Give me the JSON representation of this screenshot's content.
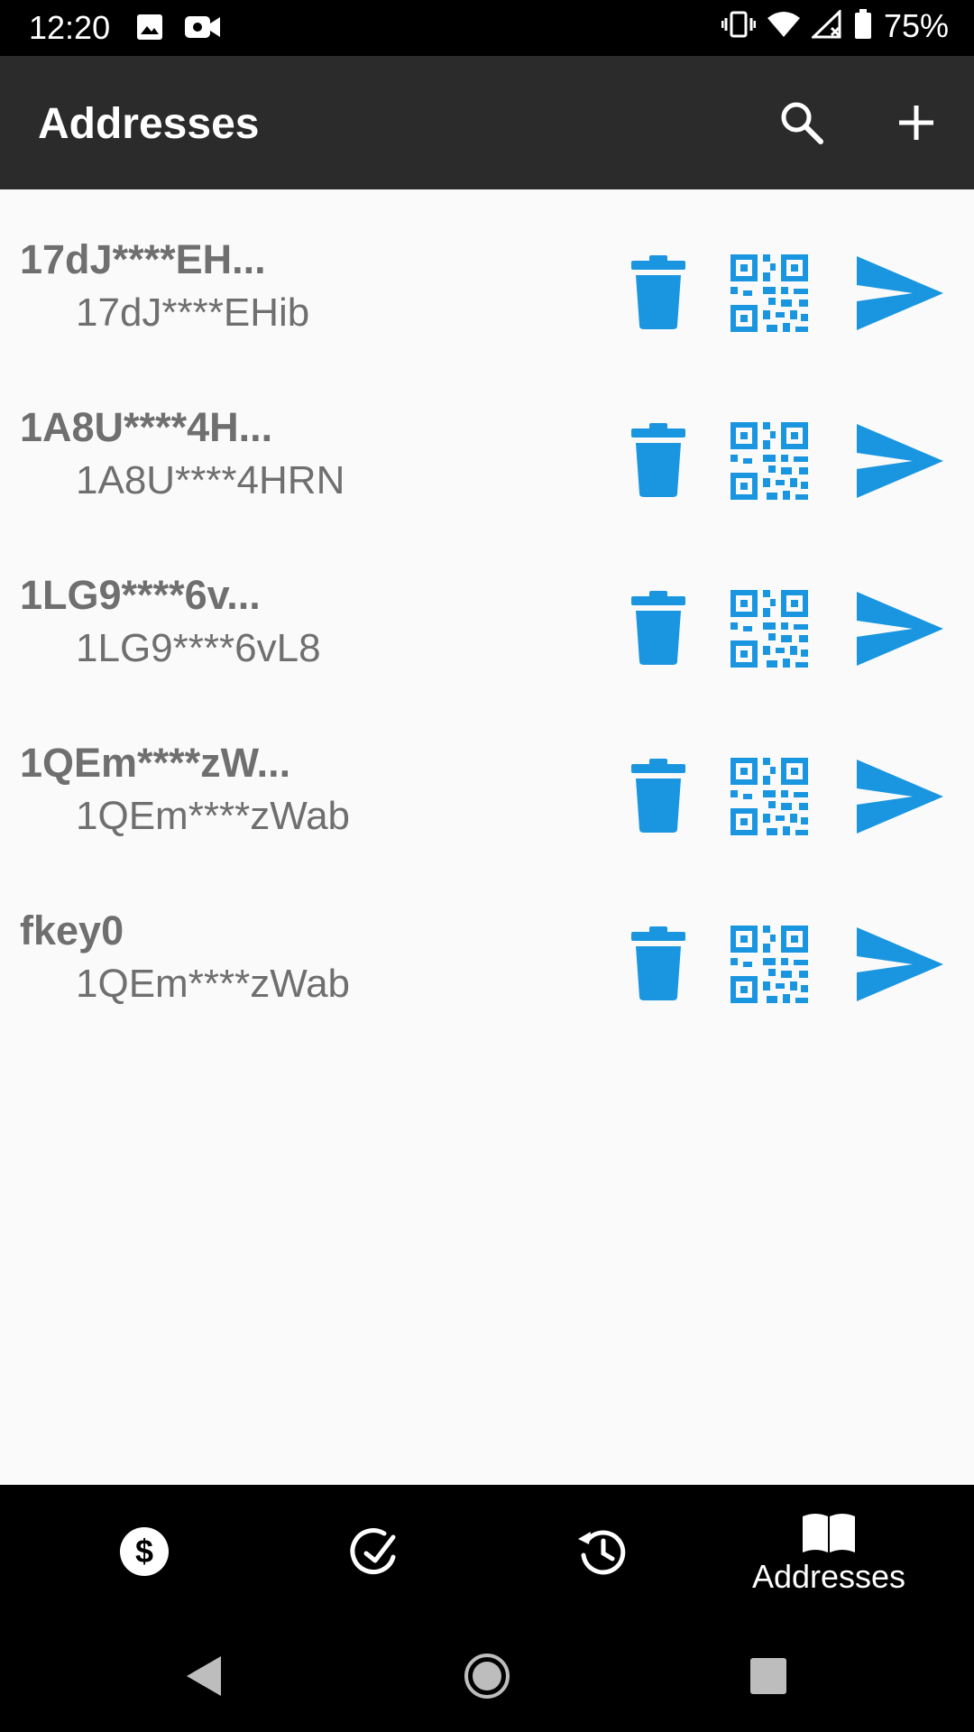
{
  "status_bar": {
    "time": "12:20",
    "battery": "75%",
    "icons": [
      "image-icon",
      "video-icon",
      "vibrate-icon",
      "wifi-icon",
      "signal-icon",
      "battery-icon"
    ]
  },
  "app_bar": {
    "title": "Addresses",
    "actions": [
      "search-icon",
      "add-icon"
    ]
  },
  "addresses": [
    {
      "label": "17dJ****EH...",
      "address": "17dJ****EHib"
    },
    {
      "label": "1A8U****4H...",
      "address": "1A8U****4HRN"
    },
    {
      "label": "1LG9****6v...",
      "address": "1LG9****6vL8"
    },
    {
      "label": "1QEm****zW...",
      "address": "1QEm****zWab"
    },
    {
      "label": "fkey0",
      "address": "1QEm****zWab"
    }
  ],
  "bottom_nav": {
    "items": [
      {
        "icon": "dollar-icon",
        "label": ""
      },
      {
        "icon": "receive-icon",
        "label": ""
      },
      {
        "icon": "history-icon",
        "label": ""
      },
      {
        "icon": "book-icon",
        "label": "Addresses",
        "active": true
      }
    ]
  },
  "colors": {
    "accent": "#1a96e0",
    "app_bar": "#2b2b2b",
    "background": "#fafafa",
    "text_secondary": "#6f6f6f"
  }
}
